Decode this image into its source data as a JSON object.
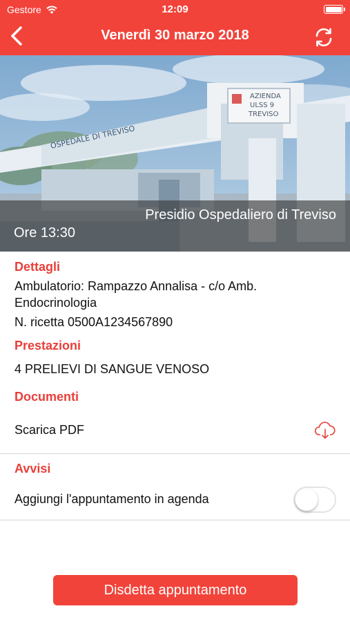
{
  "status_bar": {
    "carrier": "Gestore",
    "time": "12:09"
  },
  "nav": {
    "title": "Venerdì 30 marzo 2018"
  },
  "hero": {
    "location": "Presidio Ospedaliero di Treviso",
    "time_text": "Ore 13:30",
    "sign_text": [
      "AZIENDA",
      "ULSS 9",
      "TREVISO"
    ],
    "building_text": "OSPEDALE DI TREVISO"
  },
  "details": {
    "title": "Dettagli",
    "ambulatorio": "Ambulatorio: Rampazzo Annalisa - c/o Amb. Endocrinologia",
    "ricetta": "N. ricetta 0500A1234567890"
  },
  "prestazioni": {
    "title": "Prestazioni",
    "item": "4 PRELIEVI DI SANGUE VENOSO"
  },
  "documenti": {
    "title": "Documenti",
    "download_label": "Scarica PDF",
    "icon": "cloud-download-icon"
  },
  "avvisi": {
    "title": "Avvisi",
    "agenda_label": "Aggiungi l'appuntamento in agenda",
    "agenda_enabled": false
  },
  "actions": {
    "cancel_label": "Disdetta appuntamento"
  },
  "colors": {
    "accent": "#f2433a",
    "section_title": "#e8403a"
  }
}
